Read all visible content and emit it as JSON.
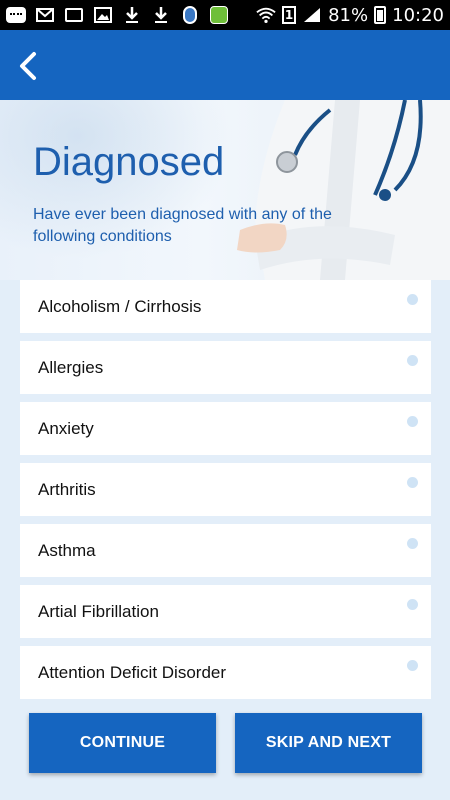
{
  "status_bar": {
    "battery": "81%",
    "time": "10:20",
    "sim": "1",
    "icons": [
      "chat-icon",
      "mail-icon",
      "tv-icon",
      "image-icon",
      "download-icon",
      "download-icon",
      "location-icon",
      "leaf-app-icon",
      "wifi-icon",
      "sim-icon",
      "signal-icon",
      "battery-icon"
    ]
  },
  "app_bar": {
    "back_icon": "chevron-left-icon"
  },
  "hero": {
    "title": "Diagnosed",
    "subtitle": "Have ever been diagnosed with any of the following conditions"
  },
  "conditions": [
    {
      "label": "Alcoholism / Cirrhosis"
    },
    {
      "label": "Allergies"
    },
    {
      "label": "Anxiety"
    },
    {
      "label": "Arthritis"
    },
    {
      "label": "Asthma"
    },
    {
      "label": "Artial Fibrillation"
    },
    {
      "label": "Attention Deficit Disorder"
    }
  ],
  "actions": {
    "continue_label": "CONTINUE",
    "skip_label": "SKIP AND NEXT"
  },
  "colors": {
    "primary": "#1565c0",
    "title_text": "#1e5fae",
    "background": "#e3eef9",
    "radio_dot": "#cfe3f5"
  }
}
